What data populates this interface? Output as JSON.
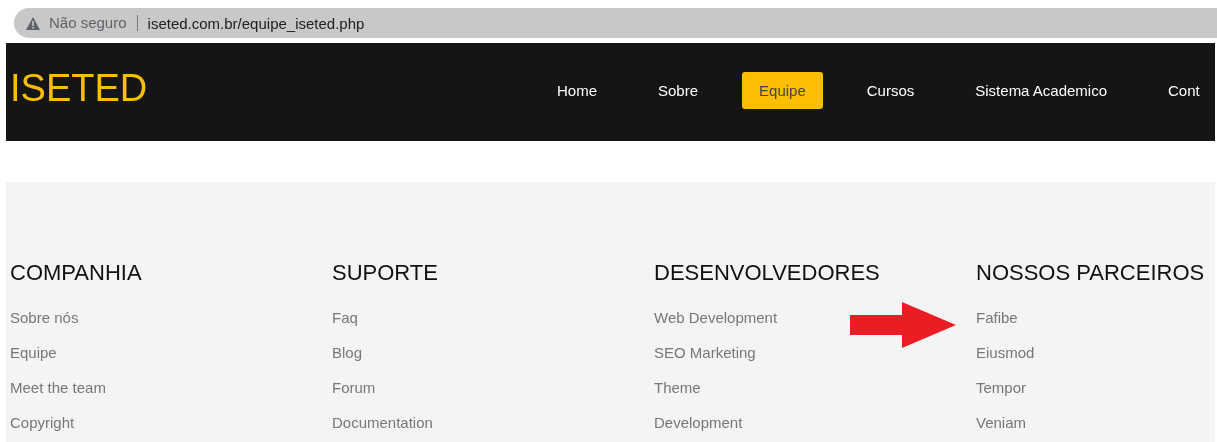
{
  "address_bar": {
    "security": "Não seguro",
    "url": "iseted.com.br/equipe_iseted.php"
  },
  "header": {
    "logo": "ISETED",
    "nav": [
      {
        "label": "Home",
        "selected": false
      },
      {
        "label": "Sobre",
        "selected": false
      },
      {
        "label": "Equipe",
        "selected": true
      },
      {
        "label": "Cursos",
        "selected": false
      },
      {
        "label": "Sistema Academico",
        "selected": false
      },
      {
        "label": "Cont",
        "selected": false
      }
    ]
  },
  "footer": {
    "columns": [
      {
        "heading": "COMPANHIA",
        "links": [
          "Sobre nós",
          "Equipe",
          "Meet the team",
          "Copyright"
        ]
      },
      {
        "heading": "SUPORTE",
        "links": [
          "Faq",
          "Blog",
          "Forum",
          "Documentation"
        ]
      },
      {
        "heading": "DESENVOLVEDORES",
        "links": [
          "Web Development",
          "SEO Marketing",
          "Theme",
          "Development"
        ]
      },
      {
        "heading": "NOSSOS PARCEIROS",
        "links": [
          "Fafibe",
          "Eiusmod",
          "Tempor",
          "Veniam"
        ]
      }
    ]
  }
}
